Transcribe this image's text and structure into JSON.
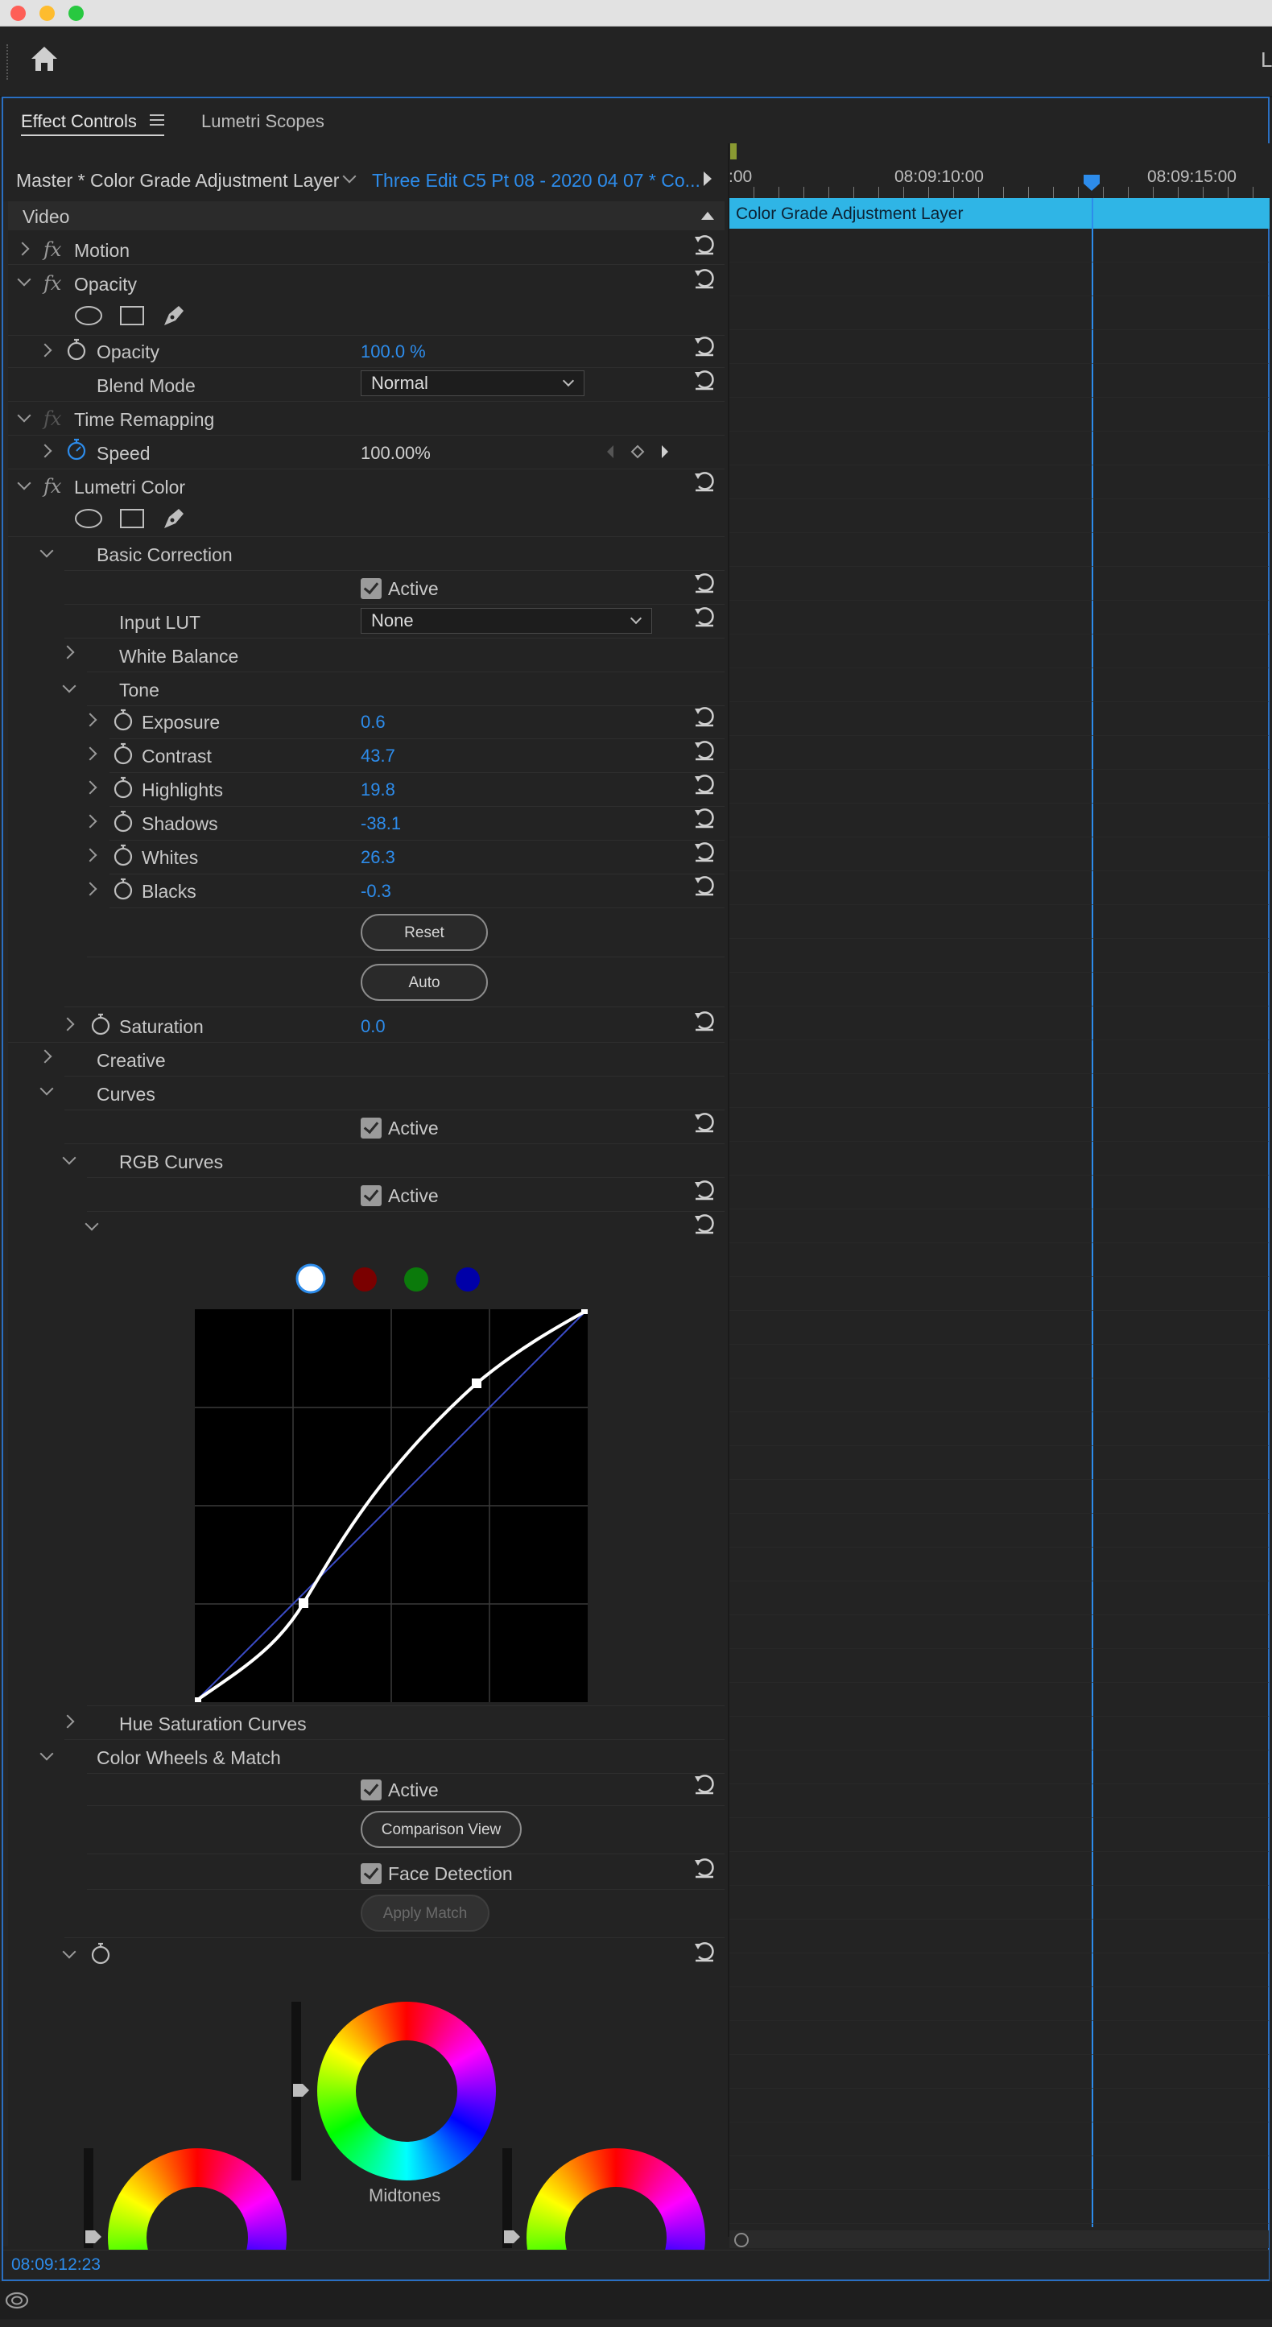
{
  "window": {
    "traffic_lights": [
      "#fe5f57",
      "#febc2e",
      "#28c840"
    ]
  },
  "toolbar": {
    "home_icon": "home-icon",
    "right_partial": "L"
  },
  "tabs": [
    {
      "label": "Effect Controls",
      "active": true
    },
    {
      "label": "Lumetri Scopes",
      "active": false
    }
  ],
  "source": {
    "master_label": "Master * Color Grade Adjustment Layer",
    "sequence_label": "Three Edit C5 Pt 08 - 2020 04 07 * Co..."
  },
  "timeline": {
    "ruler": {
      "left_partial": ":00",
      "t1": "08:09:10:00",
      "t2": "08:09:15:00"
    },
    "clip_label": "Color Grade Adjustment Layer",
    "playhead_color": "#2d8ceb",
    "clip_color": "#2fb5e6"
  },
  "video_header": "Video",
  "effects": {
    "motion": "Motion",
    "opacity_group": "Opacity",
    "opacity_label": "Opacity",
    "opacity_value": "100.0 %",
    "blend_mode_label": "Blend Mode",
    "blend_mode_value": "Normal",
    "time_remap": "Time Remapping",
    "speed_label": "Speed",
    "speed_value": "100.00%",
    "lumetri": "Lumetri Color"
  },
  "basic": {
    "title": "Basic Correction",
    "active_label": "Active",
    "input_lut_label": "Input LUT",
    "input_lut_value": "None",
    "white_balance": "White Balance",
    "tone": "Tone",
    "params": [
      {
        "label": "Exposure",
        "value": "0.6"
      },
      {
        "label": "Contrast",
        "value": "43.7"
      },
      {
        "label": "Highlights",
        "value": "19.8"
      },
      {
        "label": "Shadows",
        "value": "-38.1"
      },
      {
        "label": "Whites",
        "value": "26.3"
      },
      {
        "label": "Blacks",
        "value": "-0.3"
      }
    ],
    "reset_label": "Reset",
    "auto_label": "Auto",
    "saturation_label": "Saturation",
    "saturation_value": "0.0"
  },
  "creative": "Creative",
  "curves": {
    "title": "Curves",
    "active_label": "Active",
    "rgb_title": "RGB Curves",
    "rgb_active_label": "Active",
    "channel_colors": [
      "#ffffff",
      "#7a0000",
      "#0b7a0b",
      "#0000a8"
    ]
  },
  "hue_sat": "Hue Saturation Curves",
  "wheels": {
    "title": "Color Wheels & Match",
    "active_label": "Active",
    "comparison_label": "Comparison View",
    "face_detection_label": "Face Detection",
    "apply_match_label": "Apply Match",
    "midtones_label": "Midtones"
  },
  "status": {
    "timecode": "08:09:12:23"
  }
}
